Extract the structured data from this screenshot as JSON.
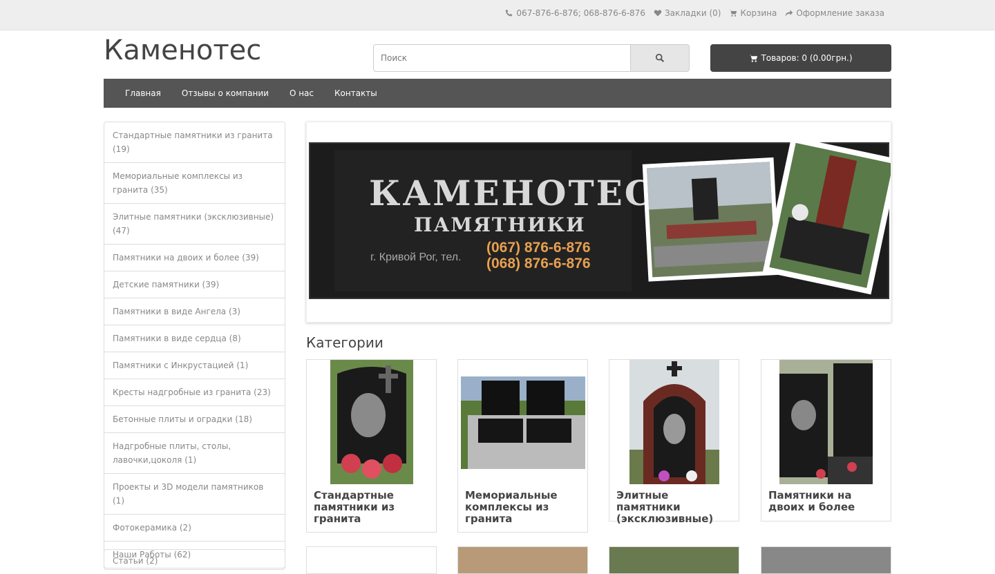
{
  "header": {
    "phone": "067-876-6-876; 068-876-6-876",
    "wishlist": "Закладки (0)",
    "cart_link": "Корзина",
    "checkout": "Оформление заказа",
    "logo": "Каменотес",
    "search_placeholder": "Поиск",
    "cart_button": "Товаров: 0 (0.00грн.)"
  },
  "nav": [
    "Главная",
    "Отзывы о компании",
    "О нас",
    "Контакты"
  ],
  "sidebar": [
    "Стандартные памятники из гранита (19)",
    "Мемориальные комплексы из гранита (35)",
    "Элитные памятники (эксклюзивные) (47)",
    "Памятники на двоих и более (39)",
    "Детские памятники (39)",
    "Памятники в виде Ангела (3)",
    "Памятники в виде сердца (8)",
    "Памятники с Инкрустацией (1)",
    "Кресты надгробные из гранита (23)",
    "Бетонные плиты и оградки (18)",
    "Надгробные плиты, столы, лавочки,цоколя (1)",
    "Проекты и 3D модели памятников (1)",
    "Фотокерамика (2)",
    "Наши Работы (62)"
  ],
  "sidebar2_label": "Статьи (2)",
  "banner": {
    "title": "КАМЕНОТЕС",
    "subtitle": "ПАМЯТНИКИ",
    "city": "г. Кривой Рог, тел.",
    "phone1": "(067) 876-6-876",
    "phone2": "(068) 876-6-876"
  },
  "section_title": "Категории",
  "categories": [
    "Стандартные памятники из гранита",
    "Мемориальные комплексы из гранита",
    "Элитные памятники (эксклюзивные)",
    "Памятники на двоих и более"
  ],
  "colors": {
    "accent": "#444444",
    "nav": "#555555",
    "banner_phone": "#e8a050"
  }
}
